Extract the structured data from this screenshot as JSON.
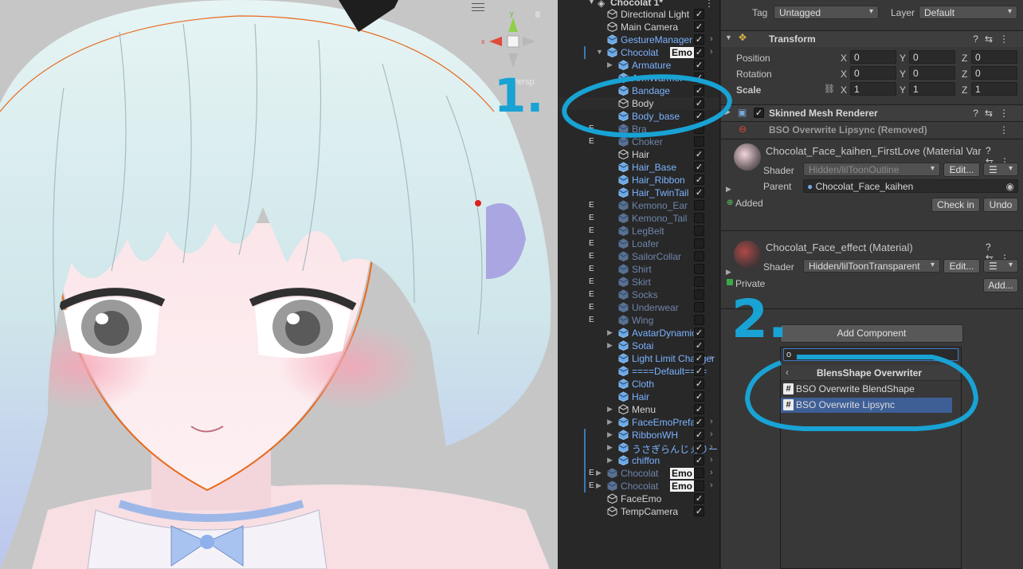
{
  "scene": {
    "gizmo_axis_x": "x",
    "gizmo_axis_y": "y",
    "gizmo_label": "Persp",
    "colors": {
      "bg": "#c6c6c6",
      "hair": "#d6ecee",
      "outline": "#e86a1e",
      "accent": "#3a79bb"
    }
  },
  "hierarchy": {
    "scene_name": "Chocolat 1*",
    "rows": [
      {
        "name": "Directional Light",
        "color": "white",
        "indent": 1,
        "checked": true,
        "arrow": false,
        "e": false,
        "bar": false,
        "more": false,
        "emo": false
      },
      {
        "name": "Main Camera",
        "color": "white",
        "indent": 1,
        "checked": true,
        "arrow": false,
        "e": false,
        "bar": false,
        "more": false,
        "emo": false
      },
      {
        "name": "GestureManager",
        "color": "blue",
        "indent": 1,
        "checked": true,
        "arrow": false,
        "e": false,
        "bar": false,
        "more": true,
        "emo": false
      },
      {
        "name": "Chocolat",
        "color": "blue",
        "indent": 1,
        "checked": true,
        "arrow": "down",
        "e": false,
        "bar": true,
        "more": true,
        "emo": true
      },
      {
        "name": "Armature",
        "color": "blue",
        "indent": 2,
        "checked": true,
        "arrow": "right",
        "e": false,
        "bar": false,
        "more": false,
        "emo": false
      },
      {
        "name": "ArmWarmer",
        "color": "blue",
        "indent": 2,
        "checked": true,
        "arrow": false,
        "e": false,
        "bar": false,
        "more": false,
        "emo": false
      },
      {
        "name": "Bandage",
        "color": "blue",
        "indent": 2,
        "checked": true,
        "arrow": false,
        "e": false,
        "bar": false,
        "more": false,
        "emo": false
      },
      {
        "name": "Body",
        "color": "white",
        "indent": 2,
        "checked": true,
        "arrow": false,
        "e": false,
        "bar": false,
        "more": false,
        "emo": false,
        "selected": true
      },
      {
        "name": "Body_base",
        "color": "blue",
        "indent": 2,
        "checked": true,
        "arrow": false,
        "e": false,
        "bar": false,
        "more": false,
        "emo": false
      },
      {
        "name": "Bra",
        "color": "dim",
        "indent": 2,
        "checked": false,
        "arrow": false,
        "e": true,
        "bar": false,
        "more": false,
        "emo": false
      },
      {
        "name": "Choker",
        "color": "dim",
        "indent": 2,
        "checked": false,
        "arrow": false,
        "e": true,
        "bar": false,
        "more": false,
        "emo": false
      },
      {
        "name": "Hair",
        "color": "white",
        "indent": 2,
        "checked": true,
        "arrow": false,
        "e": false,
        "bar": false,
        "more": false,
        "emo": false
      },
      {
        "name": "Hair_Base",
        "color": "blue",
        "indent": 2,
        "checked": true,
        "arrow": false,
        "e": false,
        "bar": false,
        "more": false,
        "emo": false
      },
      {
        "name": "Hair_Ribbon",
        "color": "blue",
        "indent": 2,
        "checked": true,
        "arrow": false,
        "e": false,
        "bar": false,
        "more": false,
        "emo": false
      },
      {
        "name": "Hair_TwinTail",
        "color": "blue",
        "indent": 2,
        "checked": true,
        "arrow": false,
        "e": false,
        "bar": false,
        "more": false,
        "emo": false
      },
      {
        "name": "Kemono_Ear",
        "color": "dim",
        "indent": 2,
        "checked": false,
        "arrow": false,
        "e": true,
        "bar": false,
        "more": false,
        "emo": false
      },
      {
        "name": "Kemono_Tail",
        "color": "dim",
        "indent": 2,
        "checked": false,
        "arrow": false,
        "e": true,
        "bar": false,
        "more": false,
        "emo": false
      },
      {
        "name": "LegBelt",
        "color": "dim",
        "indent": 2,
        "checked": false,
        "arrow": false,
        "e": true,
        "bar": false,
        "more": false,
        "emo": false
      },
      {
        "name": "Loafer",
        "color": "dim",
        "indent": 2,
        "checked": false,
        "arrow": false,
        "e": true,
        "bar": false,
        "more": false,
        "emo": false
      },
      {
        "name": "SailorCollar",
        "color": "dim",
        "indent": 2,
        "checked": false,
        "arrow": false,
        "e": true,
        "bar": false,
        "more": false,
        "emo": false
      },
      {
        "name": "Shirt",
        "color": "dim",
        "indent": 2,
        "checked": false,
        "arrow": false,
        "e": true,
        "bar": false,
        "more": false,
        "emo": false
      },
      {
        "name": "Skirt",
        "color": "dim",
        "indent": 2,
        "checked": false,
        "arrow": false,
        "e": true,
        "bar": false,
        "more": false,
        "emo": false
      },
      {
        "name": "Socks",
        "color": "dim",
        "indent": 2,
        "checked": false,
        "arrow": false,
        "e": true,
        "bar": false,
        "more": false,
        "emo": false
      },
      {
        "name": "Underwear",
        "color": "dim",
        "indent": 2,
        "checked": false,
        "arrow": false,
        "e": true,
        "bar": false,
        "more": false,
        "emo": false
      },
      {
        "name": "Wing",
        "color": "dim",
        "indent": 2,
        "checked": false,
        "arrow": false,
        "e": true,
        "bar": false,
        "more": false,
        "emo": false
      },
      {
        "name": "AvatarDynamics",
        "color": "blue",
        "indent": 2,
        "checked": true,
        "arrow": "right",
        "e": false,
        "bar": false,
        "more": false,
        "emo": false
      },
      {
        "name": "Sotai",
        "color": "blue",
        "indent": 2,
        "checked": true,
        "arrow": "right",
        "e": false,
        "bar": false,
        "more": false,
        "emo": false
      },
      {
        "name": "Light Limit Changer",
        "color": "blue",
        "indent": 2,
        "checked": true,
        "arrow": false,
        "e": false,
        "bar": false,
        "more": true,
        "emo": false
      },
      {
        "name": "====Default====",
        "color": "blue",
        "indent": 2,
        "checked": true,
        "arrow": false,
        "e": false,
        "bar": false,
        "more": false,
        "emo": false
      },
      {
        "name": "Cloth",
        "color": "blue",
        "indent": 2,
        "checked": true,
        "arrow": false,
        "e": false,
        "bar": false,
        "more": false,
        "emo": false
      },
      {
        "name": "Hair",
        "color": "blue",
        "indent": 2,
        "checked": true,
        "arrow": false,
        "e": false,
        "bar": false,
        "more": false,
        "emo": false
      },
      {
        "name": "Menu",
        "color": "white",
        "indent": 2,
        "checked": true,
        "arrow": "right",
        "e": false,
        "bar": false,
        "more": false,
        "emo": false
      },
      {
        "name": "FaceEmoPrefab",
        "color": "blue",
        "indent": 2,
        "checked": true,
        "arrow": "right",
        "e": false,
        "bar": false,
        "more": true,
        "emo": false
      },
      {
        "name": "RibbonWH",
        "color": "blue",
        "indent": 2,
        "checked": true,
        "arrow": "right",
        "e": false,
        "bar": true,
        "more": true,
        "emo": false
      },
      {
        "name": "うさぎらんじぇりー",
        "color": "blue",
        "indent": 2,
        "checked": true,
        "arrow": "right",
        "e": false,
        "bar": true,
        "more": true,
        "emo": false
      },
      {
        "name": "chiffon",
        "color": "blue",
        "indent": 2,
        "checked": true,
        "arrow": "right",
        "e": false,
        "bar": true,
        "more": true,
        "emo": false
      },
      {
        "name": "Chocolat",
        "color": "dim",
        "indent": 1,
        "checked": false,
        "arrow": "right",
        "e": true,
        "bar": true,
        "more": true,
        "emo": true
      },
      {
        "name": "Chocolat",
        "color": "dim",
        "indent": 1,
        "checked": false,
        "arrow": "right",
        "e": true,
        "bar": true,
        "more": true,
        "emo": true
      },
      {
        "name": "FaceEmo",
        "color": "white",
        "indent": 1,
        "checked": true,
        "arrow": false,
        "e": false,
        "bar": false,
        "more": false,
        "emo": false
      },
      {
        "name": "TempCamera",
        "color": "white",
        "indent": 1,
        "checked": true,
        "arrow": false,
        "e": false,
        "bar": false,
        "more": false,
        "emo": false
      }
    ],
    "emo_label": "Emo",
    "e_label": "E"
  },
  "inspector": {
    "tag_label": "Tag",
    "tag_value": "Untagged",
    "layer_label": "Layer",
    "layer_value": "Default",
    "transform": {
      "title": "Transform",
      "position_label": "Position",
      "rotation_label": "Rotation",
      "scale_label": "Scale",
      "position": [
        "0",
        "0",
        "0"
      ],
      "rotation": [
        "0",
        "0",
        "0"
      ],
      "scale": [
        "1",
        "1",
        "1"
      ],
      "axes": [
        "X",
        "Y",
        "Z"
      ]
    },
    "skinned_mesh_title": "Skinned Mesh Renderer",
    "bso_removed_title": "BSO Overwrite Lipsync (Removed)",
    "material1": {
      "title": "Chocolat_Face_kaihen_FirstLove (Material Variant)",
      "shader_label": "Shader",
      "shader_value": "Hidden/lilToonOutline",
      "edit_label": "Edit...",
      "parent_label": "Parent",
      "parent_value": "Chocolat_Face_kaihen",
      "added_label": "Added",
      "checkin_label": "Check in",
      "undo_label": "Undo"
    },
    "material2": {
      "title": "Chocolat_Face_effect (Material)",
      "shader_label": "Shader",
      "shader_value": "Hidden/lilToonTransparent",
      "edit_label": "Edit...",
      "private_label": "Private",
      "add_label": "Add..."
    },
    "add_component_label": "Add Component",
    "search_value": "o",
    "popup": {
      "header": "BlensShape Overwriter",
      "items": [
        "BSO Overwrite BlendShape",
        "BSO Overwrite Lipsync"
      ],
      "selected_index": 1
    }
  },
  "annotations": {
    "label_1": "1.",
    "label_2": "2.",
    "color": "#18a3d4"
  }
}
